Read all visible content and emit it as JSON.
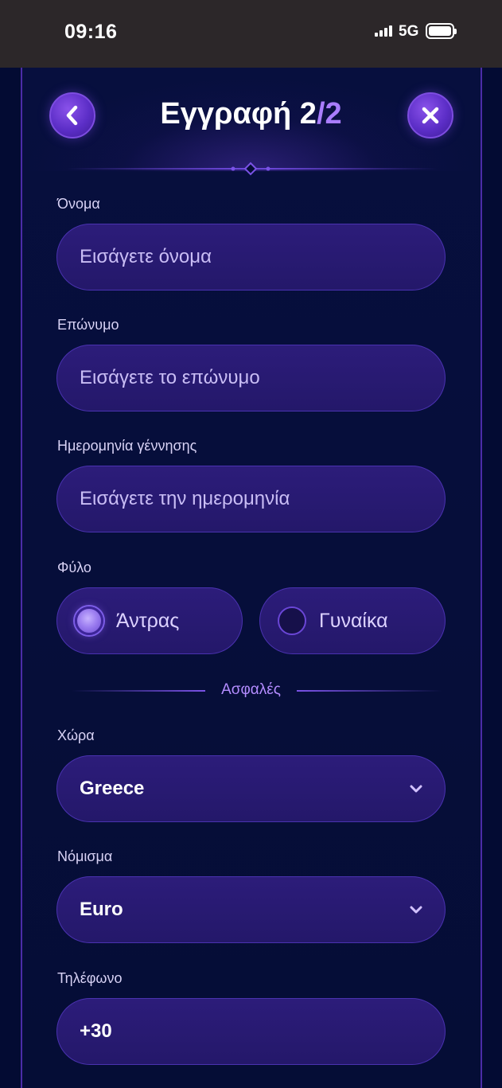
{
  "status_bar": {
    "time": "09:16",
    "network": "5G"
  },
  "header": {
    "title_main": "Εγγραφή 2",
    "title_accent": "/2",
    "back_icon": "chevron-left-icon",
    "close_icon": "close-icon"
  },
  "form": {
    "first_name": {
      "label": "Όνομα",
      "placeholder": "Εισάγετε όνομα"
    },
    "last_name": {
      "label": "Επώνυμο",
      "placeholder": "Εισάγετε το επώνυμο"
    },
    "birth_date": {
      "label": "Ημερομηνία γέννησης",
      "placeholder": "Εισάγετε την ημερομηνία"
    },
    "gender": {
      "label": "Φύλο",
      "options": [
        {
          "label": "Άντρας",
          "selected": true
        },
        {
          "label": "Γυναίκα",
          "selected": false
        }
      ]
    },
    "section_divider": "Ασφαλές",
    "country": {
      "label": "Χώρα",
      "value": "Greece"
    },
    "currency": {
      "label": "Νόμισμα",
      "value": "Euro"
    },
    "phone": {
      "label": "Τηλέφωνο",
      "value": "+30"
    }
  },
  "colors": {
    "background": "#030b33",
    "accent": "#a97dff",
    "button": "#6a36d8",
    "input_bg": "#2a1b76"
  }
}
